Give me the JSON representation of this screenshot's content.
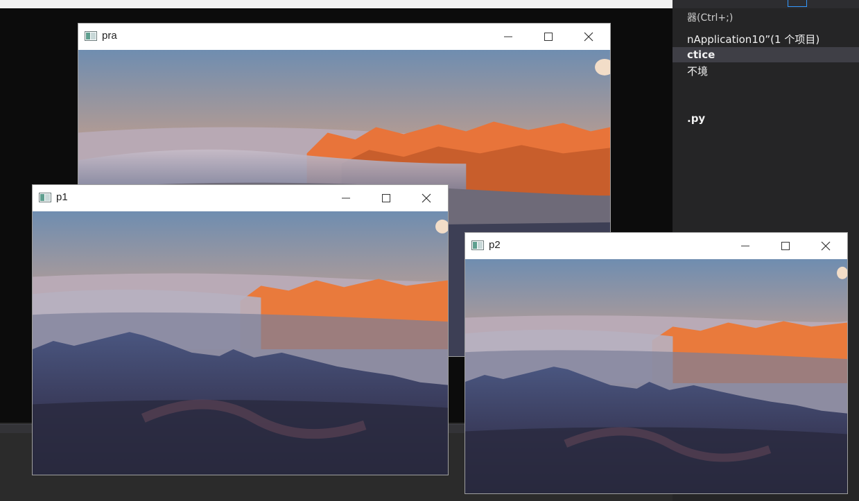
{
  "desktop": {
    "solution_explorer": {
      "search_placeholder": "器(Ctrl+;)",
      "rows": [
        {
          "text": "nApplication10”(1 个项目)",
          "bold": false
        },
        {
          "text": "ctice",
          "bold": true
        },
        {
          "text": "不境",
          "bold": false
        },
        {
          "text": ".py",
          "bold": true
        }
      ]
    }
  },
  "windows": [
    {
      "id": "pra",
      "title": "pra",
      "icon": "app-window-icon",
      "image": "badlands-sunrise-photo-full"
    },
    {
      "id": "p1",
      "title": "p1",
      "icon": "app-window-icon",
      "image": "badlands-sunrise-photo-blended"
    },
    {
      "id": "p2",
      "title": "p2",
      "icon": "app-window-icon",
      "image": "badlands-sunrise-photo-blended"
    }
  ],
  "window_controls": {
    "minimize": "minimize-icon",
    "maximize": "maximize-icon",
    "close": "close-icon"
  },
  "colors": {
    "ide_dark": "#252526",
    "console_black": "#0c0c0c",
    "titlebar": "#ffffff",
    "sky_top": "#6f8db0",
    "sky_glow": "#e9a57d",
    "rock_glow": "#ee7a35",
    "mountain_dark": "#2a3150"
  }
}
